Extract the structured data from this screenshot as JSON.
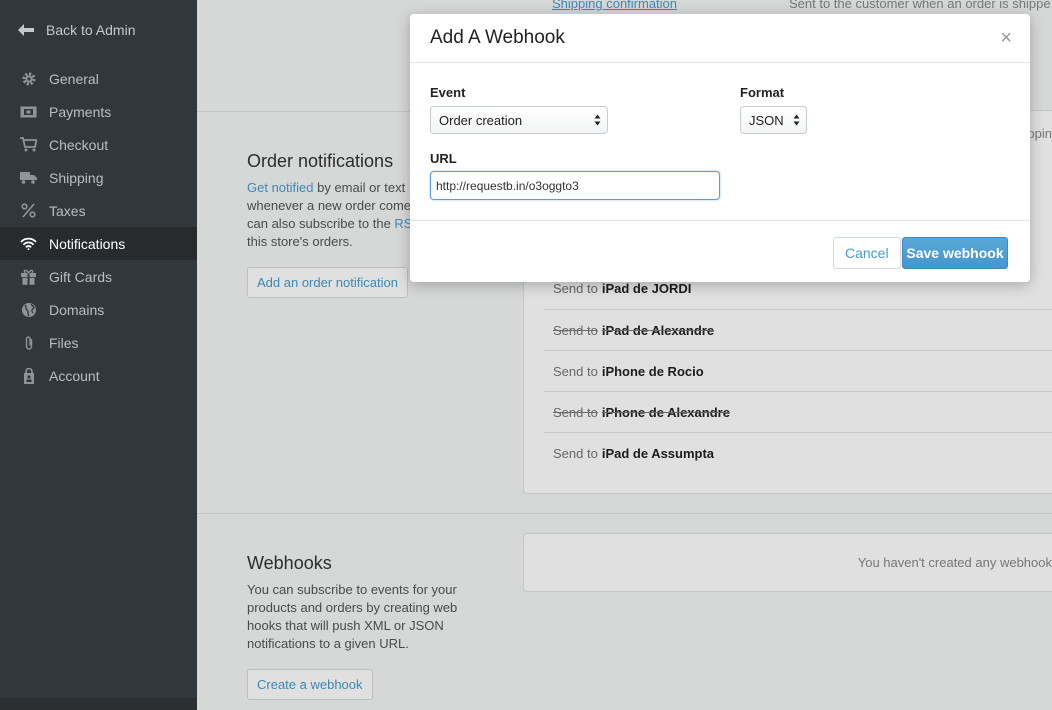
{
  "sidebar": {
    "back_label": "Back to Admin",
    "items": [
      {
        "label": "General",
        "icon": "gear-icon"
      },
      {
        "label": "Payments",
        "icon": "payments-icon"
      },
      {
        "label": "Checkout",
        "icon": "cart-icon"
      },
      {
        "label": "Shipping",
        "icon": "truck-icon"
      },
      {
        "label": "Taxes",
        "icon": "percent-icon"
      },
      {
        "label": "Notifications",
        "icon": "wifi-icon",
        "active": true
      },
      {
        "label": "Gift Cards",
        "icon": "gift-icon"
      },
      {
        "label": "Domains",
        "icon": "globe-icon"
      },
      {
        "label": "Files",
        "icon": "paperclip-icon"
      },
      {
        "label": "Account",
        "icon": "account-icon"
      }
    ]
  },
  "main": {
    "top_link": "Shipping confirmation",
    "top_text": "Sent to the customer when an order is shippe",
    "top_text_right": "ppin",
    "order_notifications": {
      "title": "Order notifications",
      "desc_link": "Get notified",
      "desc_1": " by email or text",
      "desc_2": "whenever a new order come",
      "desc_3": "can also subscribe to the ",
      "desc_rss": "RS",
      "desc_4": "this store's orders.",
      "add_button": "Add an order notification",
      "send_prefix": "Send to",
      "rows": [
        {
          "device": "iPad de JORDI",
          "disabled": false
        },
        {
          "device": "iPad de Alexandre",
          "disabled": true
        },
        {
          "device": "iPhone de Rocio",
          "disabled": false
        },
        {
          "device": "iPhone de Alexandre",
          "disabled": true
        },
        {
          "device": "iPad de Assumpta",
          "disabled": false
        }
      ]
    },
    "webhooks": {
      "title": "Webhooks",
      "desc": "You can subscribe to events for your products and orders by creating web hooks that will push XML or JSON notifications to a given URL.",
      "create_button": "Create a webhook",
      "empty_text": "You haven't created any webhook"
    }
  },
  "modal": {
    "title": "Add A Webhook",
    "close": "×",
    "event_label": "Event",
    "event_value": "Order creation",
    "format_label": "Format",
    "format_value": "JSON",
    "url_label": "URL",
    "url_value": "http://requestb.in/o3oggto3",
    "cancel": "Cancel",
    "save": "Save webhook"
  },
  "colors": {
    "sidebar_bg": "#32373b",
    "accent": "#479ccf",
    "primary_button": "#4596cc"
  }
}
